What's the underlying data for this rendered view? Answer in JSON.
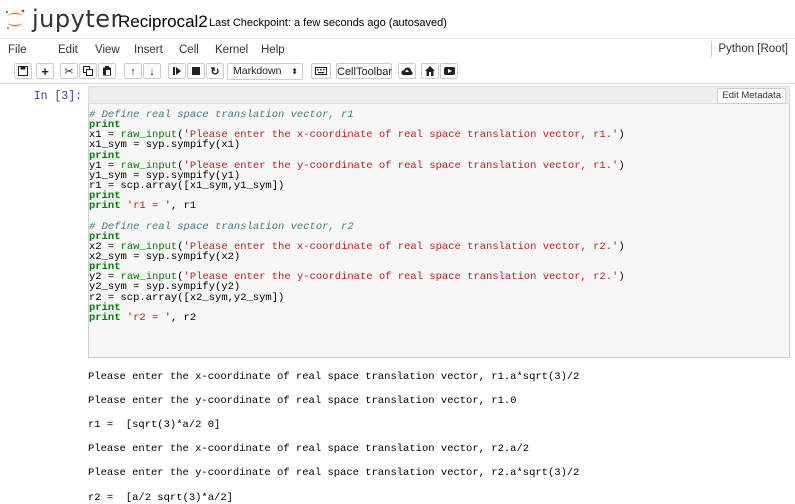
{
  "header": {
    "logo_text": "jupyter",
    "notebook_name": "Reciprocal2",
    "checkpoint": "Last Checkpoint: a few seconds ago (autosaved)"
  },
  "menu": {
    "items": [
      "File",
      "Edit",
      "View",
      "Insert",
      "Cell",
      "Kernel",
      "Help"
    ],
    "kernel_indicator": "Python [Root]"
  },
  "toolbar": {
    "buttons": [
      "save-icon",
      "plus-icon",
      "scissors-icon",
      "copy-icon",
      "paste-icon",
      "arrow-up-icon",
      "arrow-down-icon",
      "step-forward-icon",
      "stop-icon",
      "restart-icon",
      "keyboard-icon",
      "upload-icon",
      "home-icon",
      "youtube-icon"
    ],
    "cell_type": "Markdown",
    "celltoolbar_label": "CellToolbar"
  },
  "cell": {
    "prompt": "In [3]:",
    "edit_metadata_label": "Edit Metadata",
    "code_lines": [
      [
        [
          "c",
          "# Define real space translation vector, r1"
        ]
      ],
      [
        [
          "k",
          "print"
        ]
      ],
      [
        [
          "n",
          "x1 = "
        ],
        [
          "b",
          "raw_input"
        ],
        [
          "n",
          "("
        ],
        [
          "s",
          "'Please enter the x-coordinate of real space translation vector, r1.'"
        ],
        [
          "n",
          ")"
        ]
      ],
      [
        [
          "n",
          "x1_sym = syp.sympify(x1)"
        ]
      ],
      [
        [
          "k",
          "print"
        ]
      ],
      [
        [
          "n",
          "y1 = "
        ],
        [
          "b",
          "raw_input"
        ],
        [
          "n",
          "("
        ],
        [
          "s",
          "'Please enter the y-coordinate of real space translation vector, r1.'"
        ],
        [
          "n",
          ")"
        ]
      ],
      [
        [
          "n",
          "y1_sym = syp.sympify(y1)"
        ]
      ],
      [
        [
          "n",
          "r1 = scp.array([x1_sym,y1_sym])"
        ]
      ],
      [
        [
          "k",
          "print"
        ]
      ],
      [
        [
          "k",
          "print"
        ],
        [
          "n",
          " "
        ],
        [
          "s",
          "'r1 = '"
        ],
        [
          "n",
          ", r1"
        ]
      ],
      [
        [
          "n",
          ""
        ]
      ],
      [
        [
          "c",
          "# Define real space translation vector, r2"
        ]
      ],
      [
        [
          "k",
          "print"
        ]
      ],
      [
        [
          "n",
          "x2 = "
        ],
        [
          "b",
          "raw_input"
        ],
        [
          "n",
          "("
        ],
        [
          "s",
          "'Please enter the x-coordinate of real space translation vector, r2.'"
        ],
        [
          "n",
          ")"
        ]
      ],
      [
        [
          "n",
          "x2_sym = syp.sympify(x2)"
        ]
      ],
      [
        [
          "k",
          "print"
        ]
      ],
      [
        [
          "n",
          "y2 = "
        ],
        [
          "b",
          "raw_input"
        ],
        [
          "n",
          "("
        ],
        [
          "s",
          "'Please enter the y-coordinate of real space translation vector, r2.'"
        ],
        [
          "n",
          ")"
        ]
      ],
      [
        [
          "n",
          "y2_sym = syp.sympify(y2)"
        ]
      ],
      [
        [
          "n",
          "r2 = scp.array([x2_sym,y2_sym])"
        ]
      ],
      [
        [
          "k",
          "print"
        ]
      ],
      [
        [
          "k",
          "print"
        ],
        [
          "n",
          " "
        ],
        [
          "s",
          "'r2 = '"
        ],
        [
          "n",
          ", r2"
        ]
      ]
    ],
    "output_lines": [
      "Please enter the x-coordinate of real space translation vector, r1.a*sqrt(3)/2",
      "Please enter the y-coordinate of real space translation vector, r1.0",
      "r1 =  [sqrt(3)*a/2 0]",
      "Please enter the x-coordinate of real space translation vector, r2.a/2",
      "Please enter the y-coordinate of real space translation vector, r2.a*sqrt(3)/2",
      "r2 =  [a/2 sqrt(3)*a/2]"
    ]
  },
  "colors": {
    "logo_orange": "#f37726",
    "prompt_blue": "#303f9f",
    "keyword_green": "#008000",
    "string_red": "#ba2121",
    "comment_teal": "#408080"
  }
}
